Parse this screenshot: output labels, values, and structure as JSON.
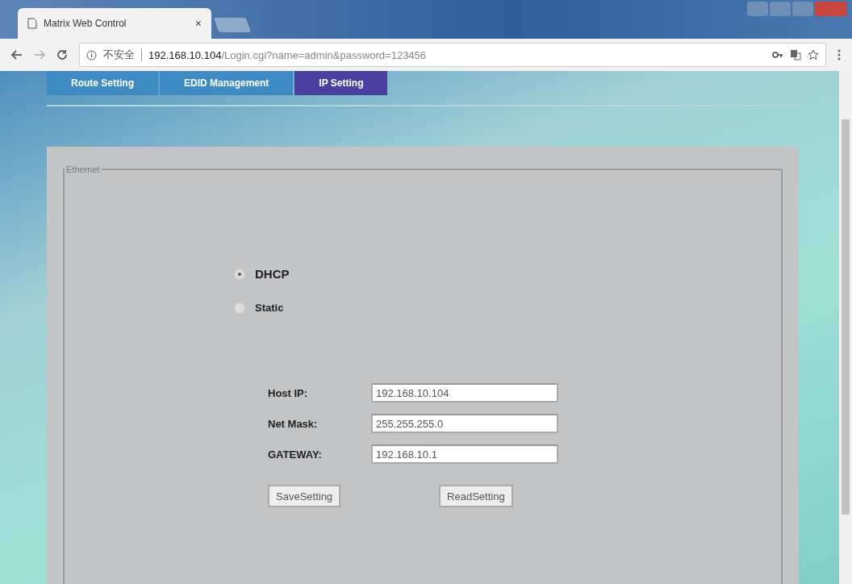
{
  "browser": {
    "tab_title": "Matrix Web Control",
    "tab_close": "×",
    "security": "不安全",
    "url_host": "192.168.10.104",
    "url_path": "/Login.cgi?name=admin&password=123456"
  },
  "nav_tabs": [
    {
      "label": "Route Setting",
      "selected": false
    },
    {
      "label": "EDID Management",
      "selected": false
    },
    {
      "label": "IP Setting",
      "selected": true
    }
  ],
  "ethernet": {
    "legend": "Ethernet",
    "modes": [
      {
        "label": "DHCP",
        "selected": true
      },
      {
        "label": "Static",
        "selected": false
      }
    ],
    "fields": [
      {
        "label": "Host IP:",
        "value": "192.168.10.104"
      },
      {
        "label": "Net Mask:",
        "value": "255.255.255.0"
      },
      {
        "label": "GATEWAY:",
        "value": "192.168.10.1"
      }
    ],
    "buttons": [
      "SaveSetting",
      "ReadSetting"
    ]
  }
}
